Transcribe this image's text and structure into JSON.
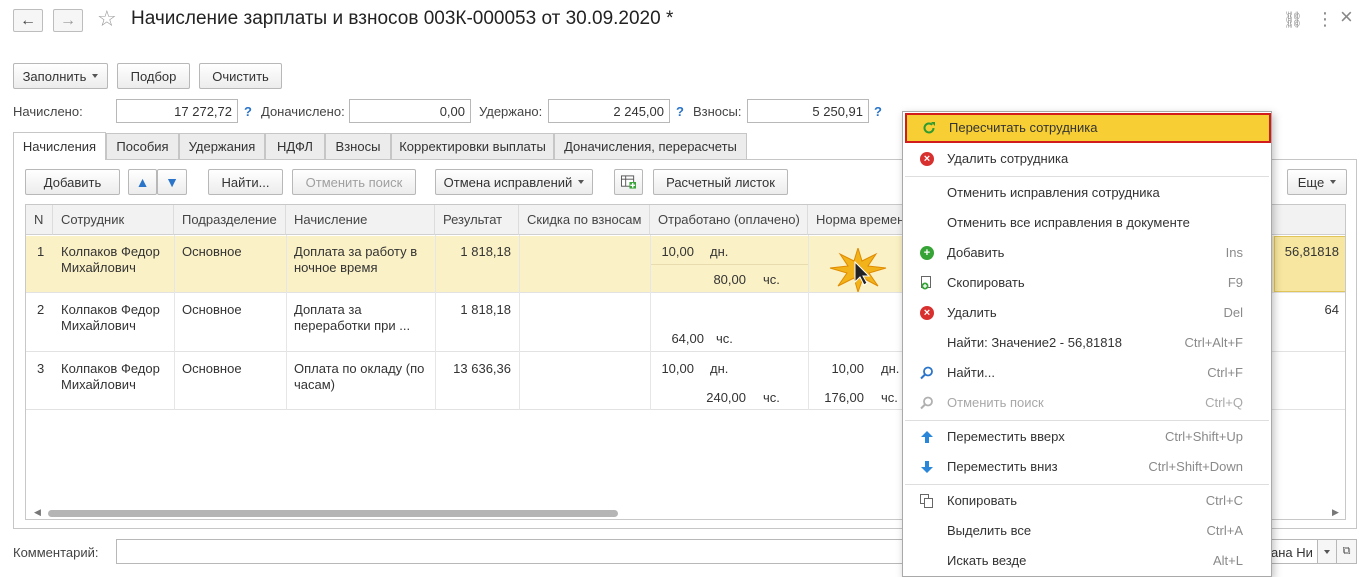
{
  "window": {
    "title": "Начисление зарплаты и взносов 003К-000053 от 30.09.2020 *",
    "back_icon": "←",
    "forward_icon": "→",
    "star_icon": "☆",
    "link_icon": "⛓",
    "more_icon": "⋮",
    "close_icon": "×"
  },
  "toolbar": {
    "fill_label": "Заполнить",
    "pick_label": "Подбор",
    "clear_label": "Очистить"
  },
  "totals": {
    "accrued_label": "Начислено:",
    "accrued_value": "17 272,72",
    "additional_label": "Доначислено:",
    "additional_value": "0,00",
    "withheld_label": "Удержано:",
    "withheld_value": "2 245,00",
    "contributions_label": "Взносы:",
    "contributions_value": "5 250,91",
    "help": "?"
  },
  "tabs": [
    "Начисления",
    "Пособия",
    "Удержания",
    "НДФЛ",
    "Взносы",
    "Корректировки выплаты",
    "Доначисления, перерасчеты"
  ],
  "grid_toolbar": {
    "add_label": "Добавить",
    "find_label": "Найти...",
    "cancel_search_label": "Отменить поиск",
    "cancel_corrections_label": "Отмена исправлений",
    "payslip_label": "Расчетный листок",
    "more_label": "Еще"
  },
  "grid": {
    "headers": [
      "N",
      "Сотрудник",
      "Подразделение",
      "Начисление",
      "Результат",
      "Скидка по взносам",
      "Отработано (оплачено)",
      "Норма времени"
    ],
    "rows": [
      {
        "n": "1",
        "employee_1": "Колпаков Федор",
        "employee_2": "Михайлович",
        "department": "Основное",
        "accrual_1": "Доплата за работу в",
        "accrual_2": "ночное время",
        "result": "1 818,18",
        "worked_days": "10,00",
        "days_unit": "дн.",
        "worked_hours": "80,00",
        "hours_unit": "чс.",
        "right_value": "56,81818"
      },
      {
        "n": "2",
        "employee_1": "Колпаков Федор",
        "employee_2": "Михайлович",
        "department": "Основное",
        "accrual_1": "Доплата за",
        "accrual_2": "переработки при ...",
        "result": "1 818,18",
        "worked_hours": "64,00",
        "hours_unit": "чс.",
        "right_value": "64"
      },
      {
        "n": "3",
        "employee_1": "Колпаков Федор",
        "employee_2": "Михайлович",
        "department": "Основное",
        "accrual_1": "Оплата по окладу (по",
        "accrual_2": "часам)",
        "result": "13 636,36",
        "worked_days": "10,00",
        "days_unit": "дн.",
        "worked_hours": "240,00",
        "hours_unit": "чс.",
        "norm_days": "10,00",
        "norm_days_unit": "дн.",
        "norm_hours": "176,00",
        "norm_hours_unit": "чс."
      }
    ]
  },
  "comment": {
    "label": "Комментарий:",
    "value": "",
    "right_text": "ана Ни"
  },
  "context_menu": {
    "items": [
      {
        "label": "Пересчитать сотрудника",
        "shortcut": "",
        "icon": "refresh-icon"
      },
      {
        "label": "Удалить сотрудника",
        "shortcut": "",
        "icon": "delete-icon"
      },
      {
        "label": "Отменить исправления сотрудника",
        "shortcut": "",
        "icon": ""
      },
      {
        "label": "Отменить все исправления в документе",
        "shortcut": "",
        "icon": ""
      },
      {
        "label": "Добавить",
        "shortcut": "Ins",
        "icon": "add-icon"
      },
      {
        "label": "Скопировать",
        "shortcut": "F9",
        "icon": "copy-row-icon"
      },
      {
        "label": "Удалить",
        "shortcut": "Del",
        "icon": "delete-icon"
      },
      {
        "label": "Найти: Значение2 - 56,81818",
        "shortcut": "Ctrl+Alt+F",
        "icon": ""
      },
      {
        "label": "Найти...",
        "shortcut": "Ctrl+F",
        "icon": "search-icon"
      },
      {
        "label": "Отменить поиск",
        "shortcut": "Ctrl+Q",
        "icon": "cancel-search-icon"
      },
      {
        "label": "Переместить вверх",
        "shortcut": "Ctrl+Shift+Up",
        "icon": "arrow-up-icon"
      },
      {
        "label": "Переместить вниз",
        "shortcut": "Ctrl+Shift+Down",
        "icon": "arrow-down-icon"
      },
      {
        "label": "Копировать",
        "shortcut": "Ctrl+C",
        "icon": "copy-icon"
      },
      {
        "label": "Выделить все",
        "shortcut": "Ctrl+A",
        "icon": ""
      },
      {
        "label": "Искать везде",
        "shortcut": "Alt+L",
        "icon": ""
      }
    ]
  },
  "colors": {
    "highlight": "#f7cf35",
    "highlight_border": "#d21c1c",
    "selected_row": "#fbf1c6",
    "accent_blue": "#2a74c9"
  }
}
